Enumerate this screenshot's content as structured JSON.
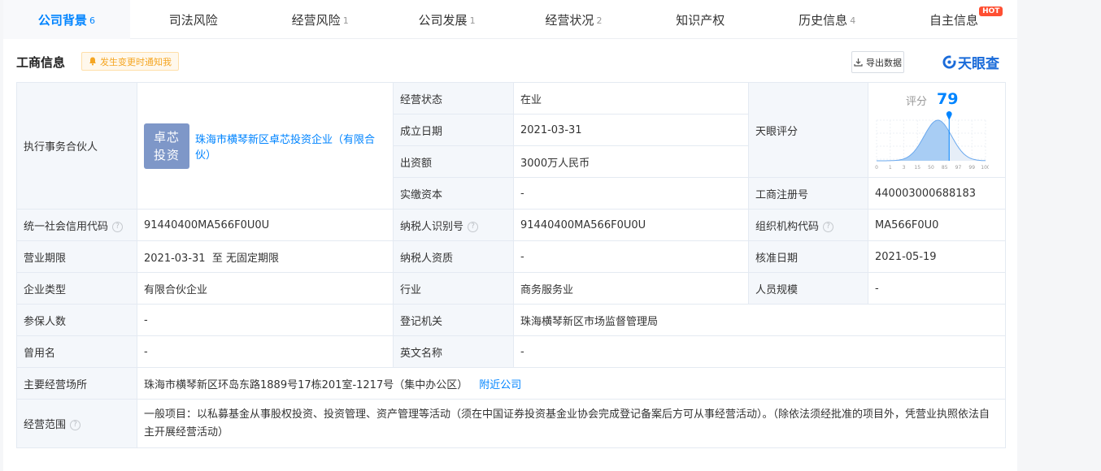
{
  "tabs": [
    {
      "label": "公司背景",
      "count": "6",
      "active": true
    },
    {
      "label": "司法风险",
      "count": ""
    },
    {
      "label": "经营风险",
      "count": "1"
    },
    {
      "label": "公司发展",
      "count": "1"
    },
    {
      "label": "经营状况",
      "count": "2"
    },
    {
      "label": "知识产权",
      "count": ""
    },
    {
      "label": "历史信息",
      "count": "4"
    },
    {
      "label": "自主信息",
      "count": "",
      "badge": "HOT"
    }
  ],
  "section": {
    "title": "工商信息",
    "notify_label": "发生变更时通知我",
    "export_label": "导出数据",
    "brand": "天眼查"
  },
  "info": {
    "partner_label": "执行事务合伙人",
    "partner_avatar_line1": "卓芯",
    "partner_avatar_line2": "投资",
    "partner_name": "珠海市横琴新区卓芯投资企业（有限合伙）",
    "status_label": "经营状态",
    "status_value": "在业",
    "founded_label": "成立日期",
    "founded_value": "2021-03-31",
    "capital_label": "出资额",
    "capital_value": "3000万人民币",
    "paid_label": "实缴资本",
    "paid_value": "-",
    "score_label": "天眼评分",
    "score_caption": "评分",
    "score_value": "79",
    "reg_no_label": "工商注册号",
    "reg_no_value": "440003000688183",
    "credit_label": "统一社会信用代码",
    "credit_value": "91440400MA566F0U0U",
    "tax_id_label": "纳税人识别号",
    "tax_id_value": "91440400MA566F0U0U",
    "org_code_label": "组织机构代码",
    "org_code_value": "MA566F0U0",
    "term_label": "营业期限",
    "term_value": "2021-03-31  至 无固定期限",
    "tax_qual_label": "纳税人资质",
    "tax_qual_value": "-",
    "approve_label": "核准日期",
    "approve_value": "2021-05-19",
    "type_label": "企业类型",
    "type_value": "有限合伙企业",
    "industry_label": "行业",
    "industry_value": "商务服务业",
    "staff_label": "人员规模",
    "staff_value": "-",
    "insured_label": "参保人数",
    "insured_value": "-",
    "authority_label": "登记机关",
    "authority_value": "珠海横琴新区市场监督管理局",
    "former_label": "曾用名",
    "former_value": "-",
    "english_label": "英文名称",
    "english_value": "-",
    "address_label": "主要经营场所",
    "address_value": "珠海市横琴新区环岛东路1889号17栋201室-1217号（集中办公区）",
    "nearby_label": "附近公司",
    "scope_label": "经营范围",
    "scope_value": "一般项目：以私募基金从事股权投资、投资管理、资产管理等活动（须在中国证券投资基金业协会完成登记备案后方可从事经营活动）。（除依法须经批准的项目外，凭营业执照依法自主开展经营活动）"
  },
  "score_chart": {
    "type": "area",
    "x_ticks": [
      "0",
      "1",
      "3",
      "15",
      "50",
      "85",
      "97",
      "99",
      "100"
    ],
    "marker_value": 79,
    "accent": "#0084ff",
    "fill": "#a8cdf4"
  }
}
